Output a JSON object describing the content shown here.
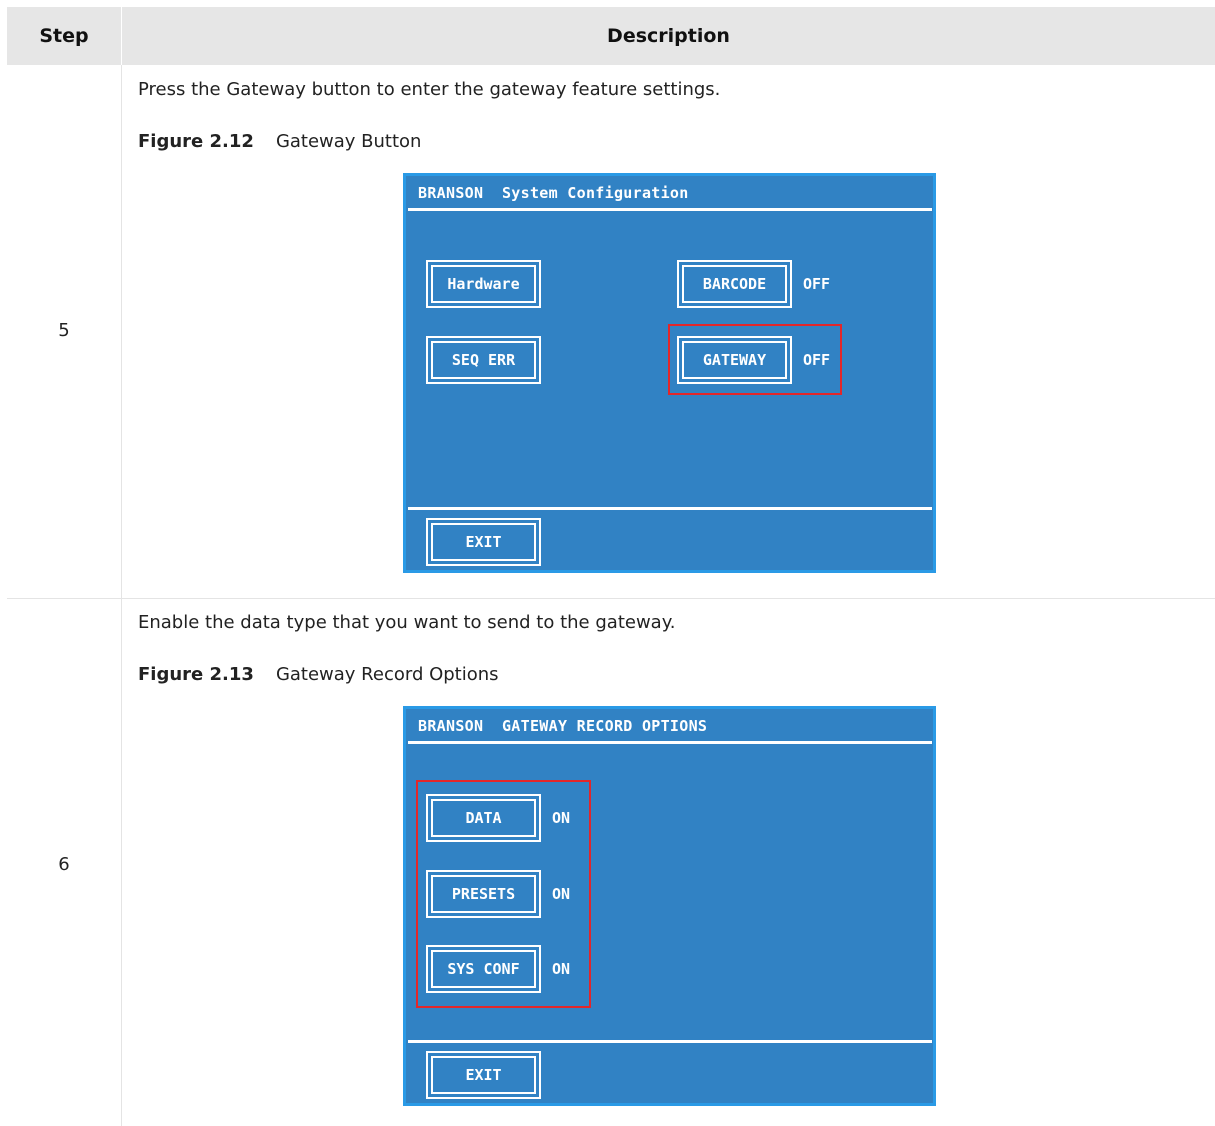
{
  "table": {
    "header_step": "Step",
    "header_description": "Description"
  },
  "rows": [
    {
      "step": "5",
      "text": "Press the Gateway button to enter the gateway feature settings.",
      "figure_label": "Figure 2.12",
      "figure_title": "Gateway Button",
      "screen": {
        "title": "BRANSON  System Configuration",
        "buttons": {
          "hardware": "Hardware",
          "barcode": "BARCODE",
          "seq_err": "SEQ ERR",
          "gateway": "GATEWAY",
          "exit": "EXIT"
        },
        "values": {
          "barcode": "OFF",
          "gateway": "OFF"
        }
      }
    },
    {
      "step": "6",
      "text": "Enable the data type that you want to send to the gateway.",
      "figure_label": "Figure 2.13",
      "figure_title": "Gateway Record Options",
      "screen": {
        "title": "BRANSON  GATEWAY RECORD OPTIONS",
        "buttons": {
          "data": "DATA",
          "presets": "PRESETS",
          "sys_conf": "SYS CONF",
          "exit": "EXIT"
        },
        "values": {
          "data": "ON",
          "presets": "ON",
          "sys_conf": "ON"
        }
      }
    }
  ],
  "colors": {
    "screen_bg": "#3182c4",
    "screen_border": "#2a9ae6",
    "highlight": "#e3262a",
    "header_bg": "#e6e6e6"
  }
}
